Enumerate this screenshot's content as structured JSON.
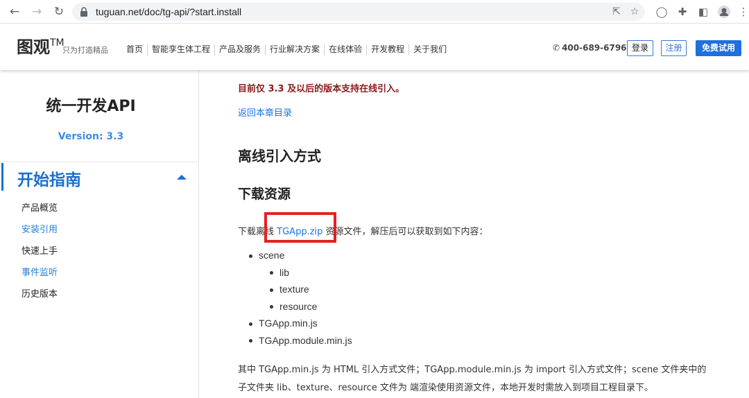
{
  "browser": {
    "url": "tuguan.net/doc/tg-api/?start.install",
    "back_icon": "←",
    "forward_icon": "→",
    "reload_icon": "↻"
  },
  "site": {
    "logo": "图观",
    "logo_tm": "TM",
    "slogan": "只为打造精品",
    "menu": [
      "首页",
      "智能孪生体工程",
      "产品及服务",
      "行业解决方案",
      "在线体验",
      "开发教程",
      "关于我们"
    ],
    "phone": "400-689-6796",
    "login": "登录",
    "register": "注册",
    "trial": "免费试用",
    "colors": {
      "accent": "#1f6fdc",
      "notice": "#8b1a1a",
      "link": "#1a73e8"
    }
  },
  "sidebar": {
    "title": "统一开发API",
    "version": "Version: 3.3",
    "section": "开始指南",
    "items": [
      {
        "label": "产品概览",
        "active": false
      },
      {
        "label": "安装引用",
        "active": true
      },
      {
        "label": "快速上手",
        "active": false
      },
      {
        "label": "事件监听",
        "active": true
      },
      {
        "label": "历史版本",
        "active": false
      }
    ]
  },
  "content": {
    "notice": "目前仅 3.3 及以后的版本支持在线引入。",
    "back_link": "返回本章目录",
    "h2": "离线引入方式",
    "h3": "下载资源",
    "para1_before": "下载离线",
    "para1_link": "TGApp.zip",
    "para1_after": "资源文件，解压后可以获取到如下内容：",
    "tree": {
      "scene": "scene",
      "lib": "lib",
      "texture": "texture",
      "resource": "resource",
      "min": "TGApp.min.js",
      "module": "TGApp.module.min.js"
    },
    "para2_line1": "其中 TGApp.min.js 为 HTML 引入方式文件；TGApp.module.min.js 为 import 引入方式文件；scene 文件夹中的",
    "para2_line2": "子文件夹 lib、texture、resource 文件为 端渲染使用资源文件，本地开发时需放入到项目工程目录下。"
  }
}
